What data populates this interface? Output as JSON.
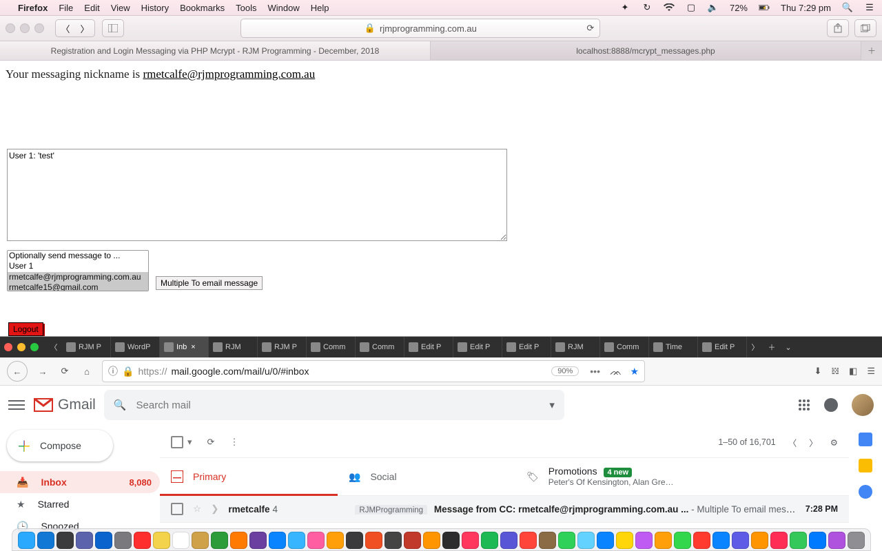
{
  "mac": {
    "app": "Firefox",
    "menus": [
      "File",
      "Edit",
      "View",
      "History",
      "Bookmarks",
      "Tools",
      "Window",
      "Help"
    ],
    "battery": "72%",
    "clock": "Thu 7:29 pm"
  },
  "safari": {
    "url_display": "rjmprogramming.com.au",
    "tabs": [
      {
        "title": "Registration and Login Messaging via PHP Mcrypt - RJM Programming - December, 2018",
        "active": true
      },
      {
        "title": "localhost:8888/mcrypt_messages.php",
        "active": false
      }
    ]
  },
  "page": {
    "nick_label": "Your messaging nickname is ",
    "nick_value": "rmetcalfe@rjmprogramming.com.au",
    "textarea_value": "User 1: 'test'",
    "select_options": [
      "Optionally send message to ...",
      "User 1",
      "rmetcalfe@rjmprogramming.com.au",
      "rmetcalfe15@gmail.com"
    ],
    "multi_to_label": "Multiple To email message",
    "logout_label": "Logout"
  },
  "firefox": {
    "tabs": [
      "RJM P",
      "WordP",
      "Inb",
      "RJM",
      "RJM P",
      "Comm",
      "Comm",
      "Edit P",
      "Edit P",
      "Edit P",
      "RJM",
      "Comm",
      "Time",
      "Edit P"
    ],
    "active_tab_index": 2,
    "url_prefix": "https://",
    "url_rest": "mail.google.com/mail/u/0/#inbox",
    "zoom": "90%"
  },
  "gmail": {
    "logo_text": "Gmail",
    "search_placeholder": "Search mail",
    "compose": "Compose",
    "side": [
      {
        "icon": "inbox",
        "label": "Inbox",
        "count": "8,080",
        "active": true
      },
      {
        "icon": "star",
        "label": "Starred"
      },
      {
        "icon": "snooze",
        "label": "Snoozed"
      }
    ],
    "page_range": "1–50 of 16,701",
    "categories": {
      "primary": "Primary",
      "social": "Social",
      "promotions": "Promotions",
      "promotions_badge": "4 new",
      "promotions_sub": "Peter's Of Kensington, Alan Gre…"
    },
    "row": {
      "sender": "rmetcalfe",
      "sender_count": "4",
      "chip": "RJMProgramming",
      "subject_bold": "Message from CC: rmetcalfe@rjmprogramming.com.au ...",
      "subject_rest": " - Multiple To email message",
      "time": "7:28 PM"
    }
  },
  "dock": {
    "count": 44,
    "colors": [
      "#2aa9ff",
      "#1178d6",
      "#3b3b3d",
      "#5b63ad",
      "#0b63ce",
      "#7a7a7e",
      "#ff2e2e",
      "#f2d34b",
      "#ffffff",
      "#cfa24a",
      "#2c9c3a",
      "#ff7a00",
      "#6b3fa0",
      "#0b84ff",
      "#37b6ff",
      "#ff5fa2",
      "#ff9f0a",
      "#3a3a3c",
      "#f04e23",
      "#444",
      "#c0392b",
      "#ff9500",
      "#2c2c2e",
      "#ff375f",
      "#1db954",
      "#5856d6",
      "#ff453a",
      "#8a6b45",
      "#30d158",
      "#64d2ff",
      "#0a84ff",
      "#ffd60a",
      "#bf5af2",
      "#ff9f0a",
      "#32d74b",
      "#ff3b30",
      "#0a84ff",
      "#5e5ce6",
      "#ff9500",
      "#ff2d55",
      "#34c759",
      "#007aff",
      "#af52de",
      "#8e8e93"
    ]
  }
}
